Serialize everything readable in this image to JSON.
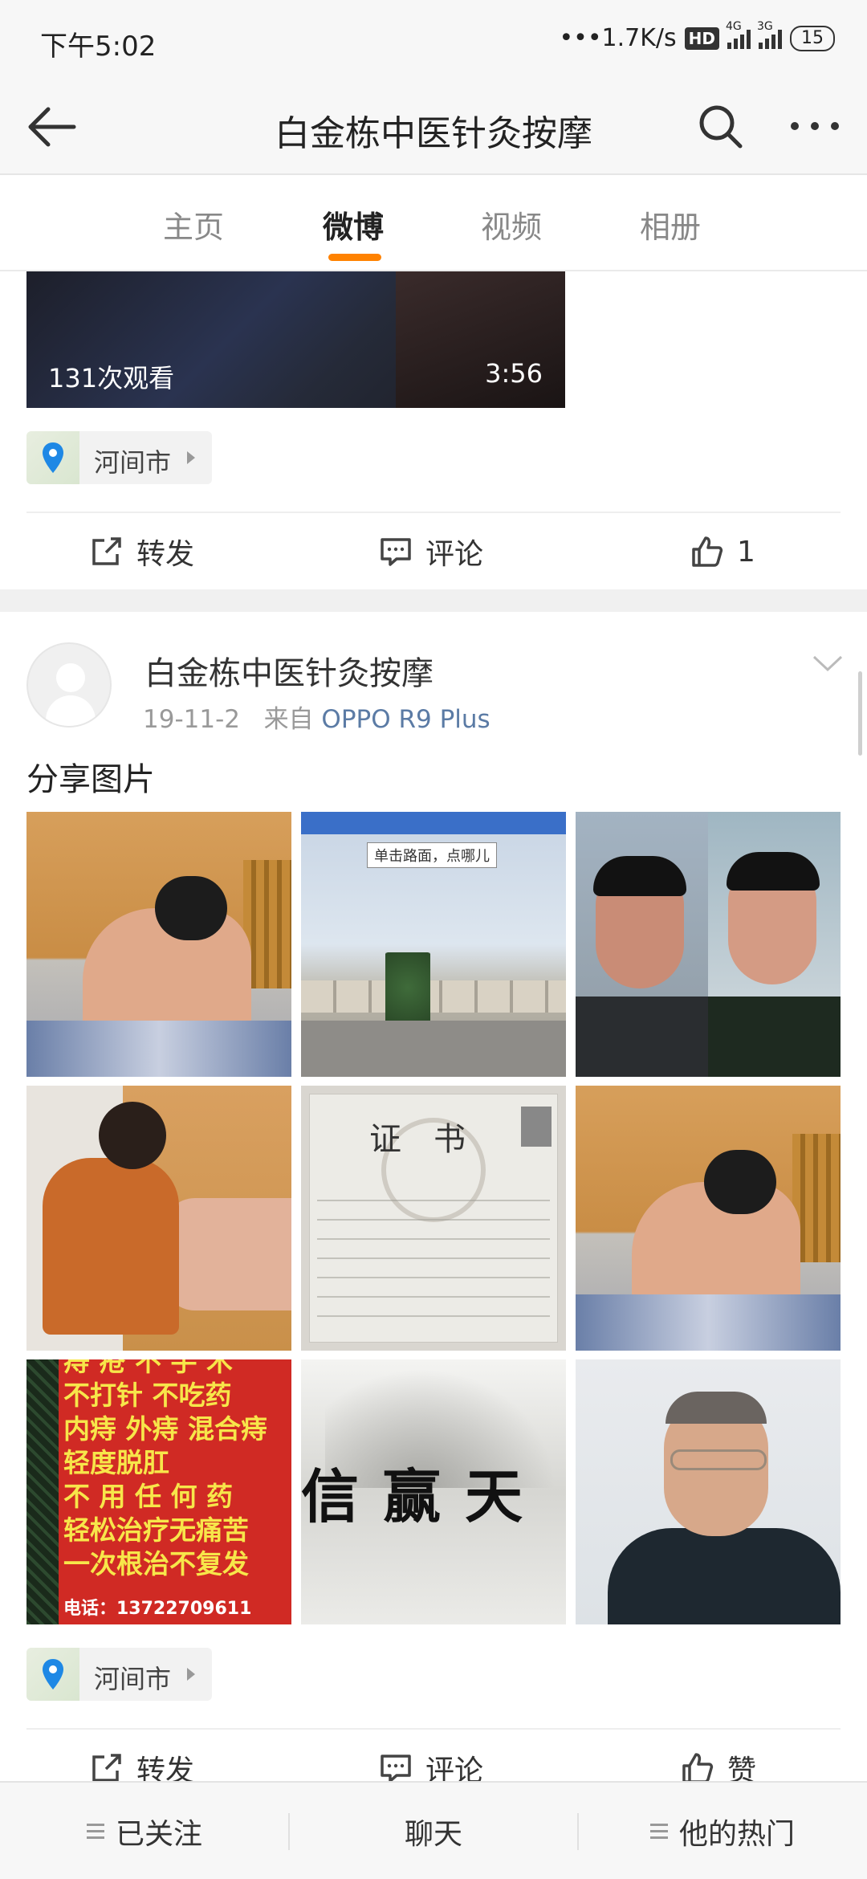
{
  "status_bar": {
    "time": "下午5:02",
    "net_speed": "•••1.7K/s",
    "hd": "HD",
    "net1": "4G",
    "net2": "3G",
    "battery": "15"
  },
  "nav": {
    "title": "白金栋中医针灸按摩",
    "back_icon": "back-arrow-icon",
    "search_icon": "search-icon",
    "more_icon": "more-icon"
  },
  "tabs": [
    {
      "label": "主页",
      "active": false
    },
    {
      "label": "微博",
      "active": true
    },
    {
      "label": "视频",
      "active": false
    },
    {
      "label": "相册",
      "active": false
    }
  ],
  "accent_color": "#ff8200",
  "prev_post": {
    "video": {
      "views": "131次观看",
      "duration": "3:56"
    },
    "location": "河间市",
    "actions": {
      "repost": "转发",
      "comment": "评论",
      "like": "1"
    }
  },
  "post": {
    "author": "白金栋中医针灸按摩",
    "date": "19-11-2",
    "from_label": "来自",
    "source": "OPPO R9 Plus",
    "text": "分享图片",
    "images": {
      "street_tip": "单击路面，点哪儿",
      "cert_title": "证书",
      "sign_lines": [
        "痔 疮 不 手 术",
        "不打针  不吃药",
        "内痔 外痔 混合痔",
        "轻度脱肛",
        "不 用 任 何 药",
        "轻松治疗无痛苦",
        "一次根治不复发"
      ],
      "sign_phone": "电话：13722709611",
      "callig_text": "信赢天"
    },
    "location": "河间市",
    "actions": {
      "repost": "转发",
      "comment": "评论",
      "like": "赞"
    }
  },
  "bottom_bar": {
    "follow": "已关注",
    "chat": "聊天",
    "hot": "他的热门"
  }
}
